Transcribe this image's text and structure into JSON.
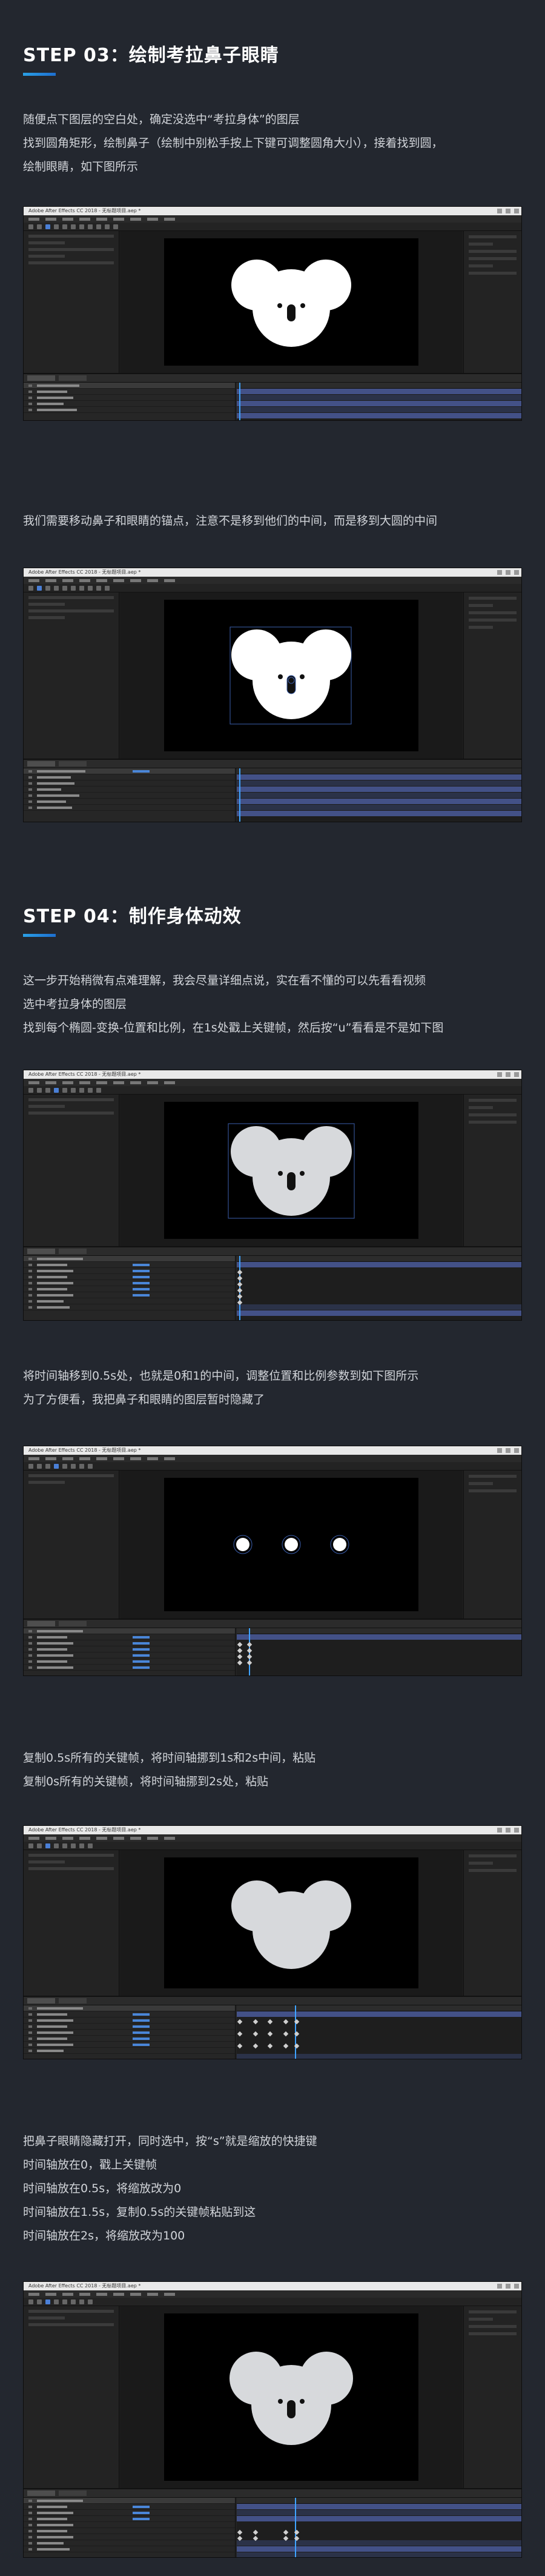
{
  "step03": {
    "title": "STEP 03：绘制考拉鼻子眼睛",
    "lines": [
      "随便点下图层的空白处，确定没选中“考拉身体”的图层",
      "找到圆角矩形，绘制鼻子（绘制中别松手按上下键可调整圆角大小），接着找到圆，",
      "绘制眼睛，如下图所示"
    ],
    "note": "我们需要移动鼻子和眼睛的锚点，注意不是移到他们的中间，而是移到大圆的中间"
  },
  "step04": {
    "title": "STEP 04：制作身体动效",
    "lines": [
      "这一步开始稍微有点难理解，我会尽量详细点说，实在看不懂的可以先看看视频",
      "选中考拉身体的图层",
      "找到每个椭圆-变换-位置和比例，在1s处戳上关键帧，然后按“u”看看是不是如下图"
    ],
    "para2": [
      "将时间轴移到0.5s处，也就是0和1的中间，调整位置和比例参数到如下图所示",
      "为了方便看，我把鼻子和眼睛的图层暂时隐藏了"
    ],
    "para3": [
      "复制0.5s所有的关键帧，将时间轴挪到1s和2s中间，粘贴",
      "复制0s所有的关键帧，将时间轴挪到2s处，粘贴"
    ],
    "para4": [
      "把鼻子眼睛隐藏打开，同时选中，按“s”就是缩放的快捷键",
      "时间轴放在0，戳上关键帧",
      "时间轴放在0.5s，将缩放改为0",
      "时间轴放在1.5s，复制0.5s的关键帧粘贴到这",
      "时间轴放在2s，将缩放改为100"
    ]
  },
  "app": {
    "window_title": "Adobe After Effects CC 2018 - 无标题项目.aep *"
  },
  "colors": {
    "accent": "#2aa0e6",
    "background": "#23272f",
    "koala_white": "#ffffff",
    "koala_grey": "#d7d9dc"
  }
}
